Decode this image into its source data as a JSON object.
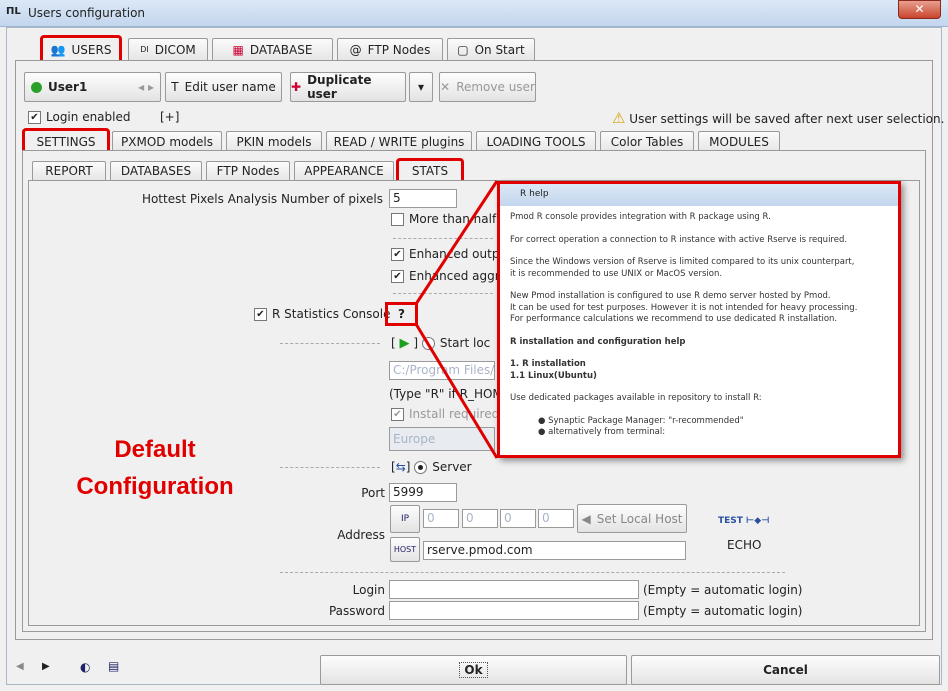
{
  "window": {
    "title": "Users configuration",
    "close": "✕"
  },
  "top_tabs": [
    {
      "label": "USERS",
      "icon": "users-icon"
    },
    {
      "label": "DICOM",
      "icon": "dicom-icon"
    },
    {
      "label": "DATABASE",
      "icon": "database-icon"
    },
    {
      "label": "FTP Nodes",
      "icon": "at-icon",
      "glyph": "@"
    },
    {
      "label": "On Start",
      "icon": "clipboard-icon"
    }
  ],
  "user": {
    "selected": "User1",
    "edit": "Edit user name",
    "duplicate": "Duplicate user",
    "remove": "Remove user",
    "login_enabled": "Login enabled",
    "plus": "[+]",
    "warning": "User settings will be saved after next user selection."
  },
  "settings_tabs": [
    "SETTINGS",
    "PXMOD models",
    "PKIN models",
    "READ / WRITE plugins",
    "LOADING TOOLS",
    "Color Tables",
    "MODULES"
  ],
  "sub_tabs": [
    "REPORT",
    "DATABASES",
    "FTP Nodes",
    "APPEARANCE",
    "STATS"
  ],
  "stats": {
    "hottest_label": "Hottest Pixels Analysis Number of pixels",
    "hottest_value": "5",
    "more_than_half": "More than half a",
    "enhanced_output": "Enhanced outpu",
    "enhanced_aggr": "Enhanced aggre",
    "r_console": "R Statistics Console",
    "help_btn": "?",
    "bracket_open": "[",
    "bracket_close": "]",
    "start_local": "Start loc",
    "path": "C:/Program Files/R",
    "type_hint": "(Type \"R\" if R_HOM",
    "install_required": "Install required",
    "region": "Europe",
    "server": "Server",
    "port_label": "Port",
    "port": "5999",
    "address_label": "Address",
    "ip": [
      "0",
      "0",
      "0",
      "0"
    ],
    "set_local_host": "Set Local Host",
    "host": "rserve.pmod.com",
    "echo": "ECHO",
    "login_label": "Login",
    "password_label": "Password",
    "login_hint": "(Empty = automatic login)",
    "password_hint": "(Empty = automatic login)"
  },
  "help": {
    "title": "R help",
    "paragraphs": [
      "Pmod R console provides integration with R package using R.",
      "For correct operation a connection to R instance with active Rserve is required.",
      "Since the Windows version of Rserve is limited compared to its unix counterpart,\nit is recommended to use UNIX or MacOS version.",
      "New Pmod installation is configured to use R demo server hosted by Pmod.\nIt can be used for test purposes. However it is not intended for heavy processing.\nFor performance calculations we recommend to use dedicated R installation."
    ],
    "heading": "R installation and configuration help",
    "sub1": "1. R installation",
    "sub2": "1.1 Linux(Ubuntu)",
    "para5": "Use dedicated packages available in repository to install R:",
    "bullets": [
      "Synaptic Package Manager: \"r-recommended\"",
      "alternatively from terminal:"
    ]
  },
  "annotation": {
    "line1": "Default",
    "line2": "Configuration"
  },
  "footer": {
    "ok": "Ok",
    "cancel": "Cancel"
  },
  "colors": {
    "highlight": "#e00000",
    "play": "#1aa01a"
  }
}
